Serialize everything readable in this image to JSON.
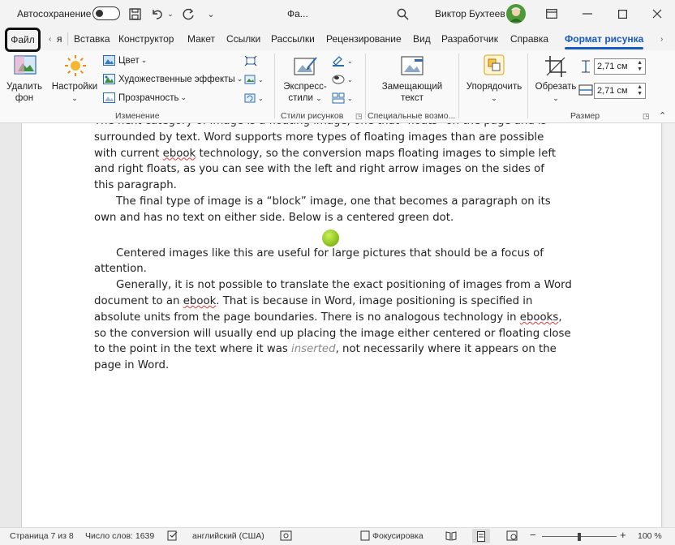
{
  "titlebar": {
    "autosave_label": "Автосохранение",
    "doc_name": "Фа...",
    "user_name": "Виктор Бухтеев"
  },
  "tabs": {
    "file": "Файл",
    "partial": "я",
    "items": [
      "Вставка",
      "Конструктор",
      "Макет",
      "Ссылки",
      "Рассылки",
      "Рецензирование",
      "Вид",
      "Разработчик",
      "Справка"
    ],
    "active": "Формат рисунка"
  },
  "ribbon": {
    "remove_bg_line1": "Удалить",
    "remove_bg_line2": "фон",
    "corrections": "Настройки",
    "color": "Цвет",
    "artistic_effects": "Художественные эффекты",
    "transparency": "Прозрачность",
    "group_adjust": "Изменение",
    "quick_styles_line1": "Экспресс-",
    "quick_styles_line2": "стили",
    "group_styles": "Стили рисунков",
    "alt_text_line1": "Замещающий",
    "alt_text_line2": "текст",
    "group_accessibility": "Специальные возмо...",
    "arrange": "Упорядочить",
    "crop": "Обрезать",
    "height_value": "2,71 см",
    "width_value": "2,71 см",
    "group_size": "Размер"
  },
  "document": {
    "p1_line0": "The next category of image is a floating image, one that \"floats\" on the page and is",
    "p1_a": "surrounded by text. Word supports more types of floating images than are possible",
    "p1_b": "with current ",
    "p1_ebook": "ebook",
    "p1_c": " technology, so the conversion maps floating images to simple left",
    "p1_d": "and right floats, as you can see with the left and right arrow images on the sides of",
    "p1_e": "this paragraph.",
    "p2": "The final type of image is a “block” image, one that becomes a paragraph on its own and has no text on either side. Below is a centered green dot.",
    "p3": "Centered images like this are useful for large pictures that should be a focus of attention.",
    "p4_a": "Generally, it is not possible to translate the exact positioning of images from a Word document to an ",
    "p4_ebook1": "ebook",
    "p4_b": ". That is because in Word, image positioning is specified in absolute units from the page boundaries.  There is no analogous technology in ",
    "p4_ebook2": "ebooks",
    "p4_c": ", so the conversion will usually end up placing the image either centered or floating close to the point in the text where it was ",
    "p4_inserted": "inserted",
    "p4_d": ", not necessarily where it appears on the page in Word."
  },
  "statusbar": {
    "page": "Страница 7 из 8",
    "words": "Число слов: 1639",
    "language": "английский (США)",
    "focus": "Фокусировка",
    "zoom": "100 %"
  }
}
